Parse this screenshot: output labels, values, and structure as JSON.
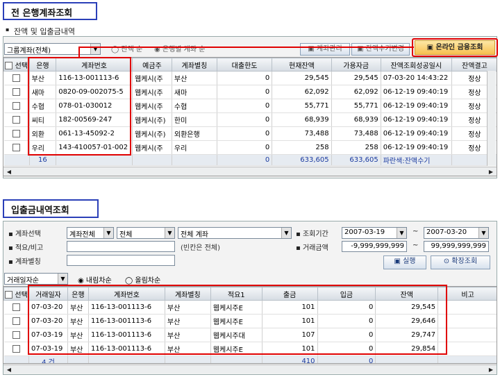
{
  "top": {
    "section_title": "전 은행계좌조회",
    "subtitle": "잔액 및 입출금내역",
    "group_combo": "그룹계좌(전체)",
    "radio_balance": "잔액 순",
    "radio_bank": "은행별 계좌 순",
    "btn_account_mgmt": "계좌관리",
    "btn_balance_edit": "잔액수기변경",
    "btn_online": "온라인 금융조회",
    "columns": [
      "선택",
      "은행",
      "계좌번호",
      "예금주",
      "계좌별칭",
      "대출한도",
      "현재잔액",
      "가용자금",
      "잔액조회성공일시",
      "잔액결고"
    ],
    "rows": [
      {
        "bank": "부산",
        "account": "116-13-001113-6",
        "owner": "웹케시(주",
        "alias": "부산",
        "loan": "0",
        "balance": "29,545",
        "available": "29,545",
        "datetime": "07-03-20 14:43:22",
        "result": "정상"
      },
      {
        "bank": "새마",
        "account": "0820-09-002075-5",
        "owner": "웹케시(주",
        "alias": "새마",
        "loan": "0",
        "balance": "62,092",
        "available": "62,092",
        "datetime": "06-12-19 09:40:19",
        "result": "정상"
      },
      {
        "bank": "수협",
        "account": "078-01-030012",
        "owner": "웹케시(주",
        "alias": "수협",
        "loan": "0",
        "balance": "55,771",
        "available": "55,771",
        "datetime": "06-12-19 09:40:19",
        "result": "정상"
      },
      {
        "bank": "씨티",
        "account": "182-00569-247",
        "owner": "웹케시(주)",
        "alias": "한미",
        "loan": "0",
        "balance": "68,939",
        "available": "68,939",
        "datetime": "06-12-19 09:40:19",
        "result": "정상"
      },
      {
        "bank": "외환",
        "account": "061-13-45092-2",
        "owner": "웹케시(주)",
        "alias": "외환은행",
        "loan": "0",
        "balance": "73,488",
        "available": "73,488",
        "datetime": "06-12-19 09:40:19",
        "result": "정상"
      },
      {
        "bank": "우리",
        "account": "143-410057-01-002",
        "owner": "웹케시(주",
        "alias": "우리",
        "loan": "0",
        "balance": "258",
        "available": "258",
        "datetime": "06-12-19 09:40:19",
        "result": "정상"
      }
    ],
    "footer": {
      "count": "16",
      "loan": "0",
      "balance": "633,605",
      "available": "633,605",
      "note": "파란색:잔액수기"
    }
  },
  "bottom": {
    "section_title": "입출금내역조회",
    "label_account": "계좌선택",
    "combo_account_type": "계좌전체",
    "combo_all": "전체",
    "combo_account": "전체 계좌",
    "label_period": "조회기간",
    "date_from": "2007-03-19",
    "date_to": "2007-03-20",
    "tilde1": "~",
    "tilde2": "~",
    "label_memo": "적요/비고",
    "memo_hint": "(빈칸은 전체)",
    "label_amount": "거래금액",
    "amount_from": "-9,999,999,999",
    "amount_to": "99,999,999,999",
    "label_alias": "계좌별칭",
    "btn_run": "실행",
    "btn_extended": "확장조회",
    "sort_combo": "거래일자순",
    "radio_desc": "내림차순",
    "radio_asc": "올림차순",
    "columns": [
      "선택",
      "거래일자",
      "은행",
      "계좌번호",
      "계좌별칭",
      "적요1",
      "출금",
      "입금",
      "잔액",
      "비고"
    ],
    "rows": [
      {
        "date": "07-03-20",
        "bank": "부산",
        "account": "116-13-001113-6",
        "alias": "부산",
        "memo": "웹케시주E",
        "out": "101",
        "in": "0",
        "balance": "29,545"
      },
      {
        "date": "07-03-20",
        "bank": "부산",
        "account": "116-13-001113-6",
        "alias": "부산",
        "memo": "웹케시주E",
        "out": "101",
        "in": "0",
        "balance": "29,646"
      },
      {
        "date": "07-03-19",
        "bank": "부산",
        "account": "116-13-001113-6",
        "alias": "부산",
        "memo": "웹케시주대",
        "out": "107",
        "in": "0",
        "balance": "29,747"
      },
      {
        "date": "07-03-19",
        "bank": "부산",
        "account": "116-13-001113-6",
        "alias": "부산",
        "memo": "웹케시주E",
        "out": "101",
        "in": "0",
        "balance": "29,854"
      }
    ],
    "footer": {
      "count": "4 건",
      "out": "410",
      "in": "0"
    }
  }
}
